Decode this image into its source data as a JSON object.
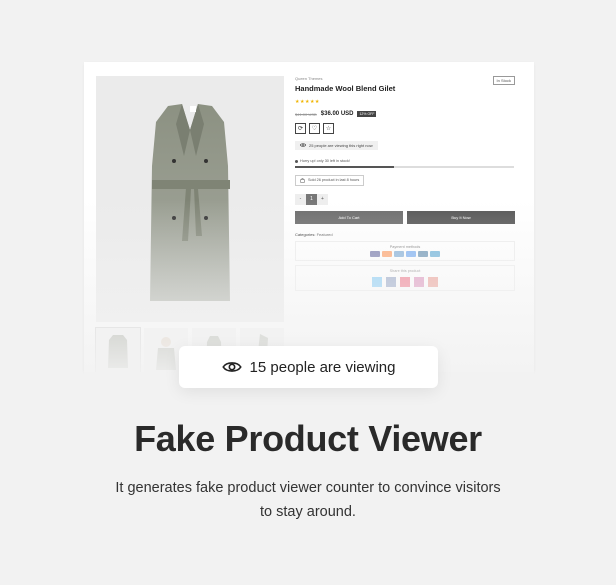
{
  "product": {
    "brand": "Queen Themes",
    "title": "Handmade Wool Blend Gilet",
    "stock_badge": "In Stock",
    "rating_stars": "★★★★★",
    "old_price": "$41.00 USD",
    "new_price": "$36.00 USD",
    "sale_badge": "12% OFF",
    "viewing_text": "25 people are viewing this right now",
    "hurry_text": "Hurry up! only 30 left in stock!",
    "stock_progress": 0.45,
    "sold_text": "Sold 26 product in last 8 hours",
    "qty_minus": "-",
    "qty_value": "1",
    "qty_plus": "+",
    "add_to_cart": "Add To Cart",
    "buy_now": "Buy It Now",
    "categories_label": "Categories:",
    "categories_value": "Featured",
    "payment_title": "Payment methods",
    "share_title": "Share this product"
  },
  "colors": {
    "garment": "#8c9182",
    "payment": [
      "#1a1f71",
      "#ff5f00",
      "#2e77bc",
      "#1a73e8",
      "#00457c",
      "#0079be"
    ],
    "share": [
      "#1da1f2",
      "#3b5998",
      "#e60023",
      "#c13584",
      "#dd4b39"
    ]
  },
  "overlay": {
    "viewing_count_text": "15 people are viewing",
    "icon": "eye-icon"
  },
  "feature": {
    "heading": "Fake Product Viewer",
    "description": "It generates fake product viewer counter to convince visitors to stay around."
  }
}
